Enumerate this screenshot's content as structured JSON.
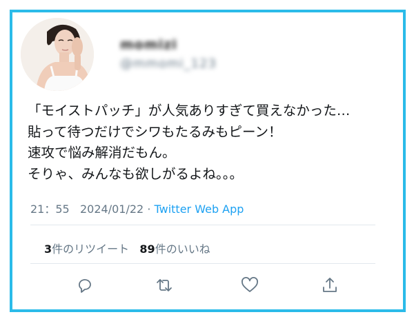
{
  "user": {
    "display_name": "momizi",
    "handle": "@mmomi_123"
  },
  "tweet": {
    "lines": [
      "「モイストパッチ」が人気ありすぎて買えなかった…",
      "貼って待つだけでシワもたるみもピーン！",
      "速攻で悩み解消だもん。",
      "そりゃ、みんなも欲しがるよね。。。"
    ],
    "time": "21：55",
    "date": "2024/01/22",
    "separator": "·",
    "app": "Twitter Web App"
  },
  "stats": {
    "retweet_count": "3",
    "retweet_label": "件のリツイート",
    "like_count": "89",
    "like_label": "件のいいね"
  },
  "actions": [
    "reply-icon",
    "retweet-icon",
    "like-icon",
    "share-icon"
  ],
  "colors": {
    "frame_border": "#2bbbe9",
    "link": "#1da1f2",
    "muted": "#657786",
    "icon": "#657786"
  }
}
